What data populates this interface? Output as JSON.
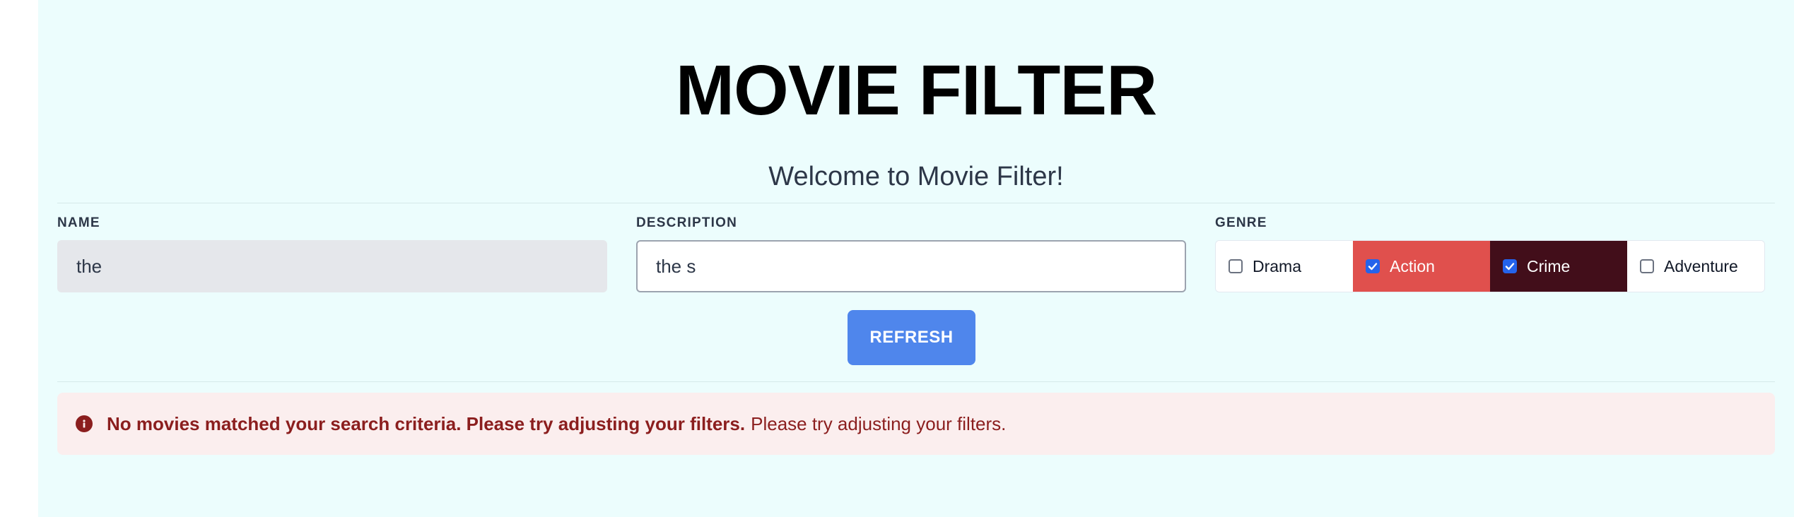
{
  "header": {
    "title": "MOVIE FILTER",
    "subtitle": "Welcome to Movie Filter!"
  },
  "filters": {
    "name": {
      "label": "NAME",
      "value": "the"
    },
    "description": {
      "label": "DESCRIPTION",
      "value": "the s"
    },
    "genre": {
      "label": "GENRE",
      "options": [
        {
          "label": "Drama",
          "checked": false
        },
        {
          "label": "Action",
          "checked": true,
          "color": "#e0504d"
        },
        {
          "label": "Crime",
          "checked": true,
          "color": "#420e1a"
        },
        {
          "label": "Adventure",
          "checked": false
        }
      ]
    }
  },
  "actions": {
    "refresh_label": "REFRESH"
  },
  "alert": {
    "icon": "info-icon",
    "strong_text": "No movies matched your search criteria. Please try adjusting your filters.",
    "text": "Please try adjusting your filters."
  },
  "colors": {
    "background": "#ecfdfd",
    "accent": "#4f86ec",
    "alert_text": "#8b1e1e",
    "alert_bg": "#fbeeee"
  }
}
